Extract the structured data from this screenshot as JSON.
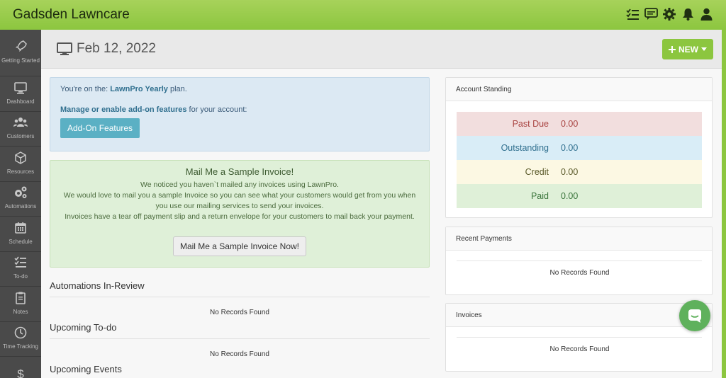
{
  "app": {
    "title": "Gadsden Lawncare"
  },
  "topbar": {
    "icons": [
      "todo-list-icon",
      "chat-icon",
      "gear-icon",
      "bell-icon",
      "user-icon"
    ]
  },
  "sidebar": {
    "items": [
      {
        "label": "Getting Started",
        "icon": "rocket-icon"
      },
      {
        "label": "Dashboard",
        "icon": "monitor-icon"
      },
      {
        "label": "Customers",
        "icon": "users-icon"
      },
      {
        "label": "Resources",
        "icon": "cube-icon"
      },
      {
        "label": "Automations",
        "icon": "gears-icon"
      },
      {
        "label": "Schedule",
        "icon": "calendar-icon"
      },
      {
        "label": "To-do",
        "icon": "checklist-icon"
      },
      {
        "label": "Notes",
        "icon": "clipboard-icon"
      },
      {
        "label": "Time Tracking",
        "icon": "clock-icon"
      },
      {
        "label": "",
        "icon": "dollar-icon"
      }
    ]
  },
  "header": {
    "date": "Feb 12, 2022",
    "new_button": "NEW"
  },
  "plan": {
    "prefix": "You're on the: ",
    "plan_name": "LawnPro Yearly",
    "suffix": " plan.",
    "manage_bold": "Manage or enable add-on features",
    "manage_rest": " for your account:",
    "addon_button": "Add-On Features"
  },
  "sample": {
    "title": "Mail Me a Sample Invoice!",
    "line1": "We noticed you haven`t mailed any invoices using LawnPro.",
    "line2": "We would love to mail you a sample Invoice so you can see what your customers would get from you when",
    "line3": "you use our mailing services to send your invoices.",
    "line4": "Invoices have a tear off payment slip and a return envelope for your customers to mail back your payment.",
    "button": "Mail Me a Sample Invoice Now!"
  },
  "sections": {
    "automations": "Automations In-Review",
    "todo": "Upcoming To-do",
    "events": "Upcoming Events",
    "no_records": "No Records Found"
  },
  "account_standing": {
    "title": "Account Standing",
    "rows": [
      {
        "label": "Past Due",
        "value": "0.00",
        "color": "#a94442",
        "bg": "#f2dede"
      },
      {
        "label": "Outstanding",
        "value": "0.00",
        "color": "#31708f",
        "bg": "#d9edf7"
      },
      {
        "label": "Credit",
        "value": "0.00",
        "color": "#5a5a2a",
        "bg": "#fcf8e3"
      },
      {
        "label": "Paid",
        "value": "0.00",
        "color": "#3c763d",
        "bg": "#dff0d8"
      }
    ]
  },
  "recent_payments": {
    "title": "Recent Payments",
    "empty": "No Records Found"
  },
  "invoices": {
    "title": "Invoices",
    "empty": "No Records Found"
  },
  "colors": {
    "accent": "#8cc63f",
    "sidebar": "#4a4a4a",
    "info_btn": "#5bb0c4",
    "chat": "#5fb15c"
  }
}
